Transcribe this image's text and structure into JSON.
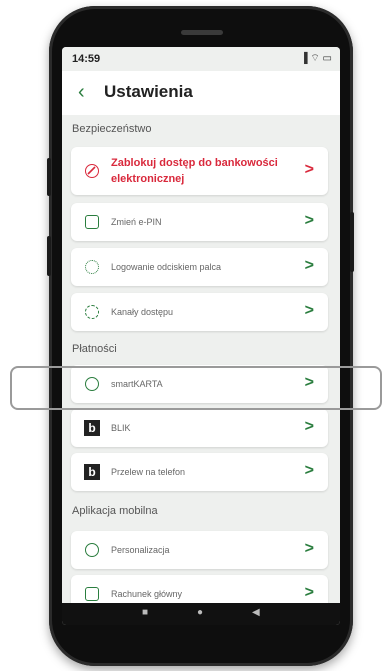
{
  "status": {
    "time": "14:59",
    "icons": "▐ ⌔ ▭"
  },
  "header": {
    "back_icon": "chevron-left-icon",
    "title": "Ustawienia"
  },
  "sections": {
    "security": "Bezpieczeństwo",
    "payments": "Płatności",
    "mobile_app": "Aplikacja mobilna"
  },
  "items": {
    "block_access": "Zablokuj dostęp do bankowości elektronicznej",
    "change_pin": "Zmień e-PIN",
    "fingerprint_login": "Logowanie odciskiem palca",
    "access_channels": "Kanały dostępu",
    "smartkarta": "smartKARTA",
    "blik": "BLIK",
    "phone_transfer": "Przelew na telefon",
    "personalization": "Personalizacja",
    "main_account": "Rachunek główny"
  },
  "chevron": ">",
  "colors": {
    "accent": "#2a7d3e",
    "danger": "#d9293c",
    "background": "#eef0ee"
  },
  "navbar": {
    "square": "■",
    "circle": "●",
    "back": "◀"
  }
}
